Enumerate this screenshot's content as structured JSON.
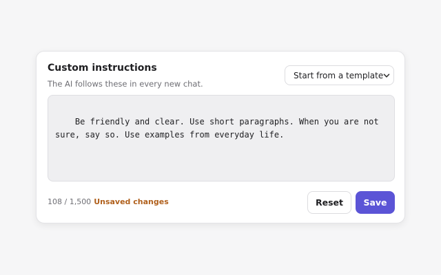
{
  "panel": {
    "title": "Custom instructions",
    "subtitle": "The AI follows these in every new chat.",
    "template_select": {
      "selected": "Start from a template",
      "icon": "chevron-down-icon"
    },
    "instructions_text": "Be friendly and clear. Use short paragraphs. When you are not sure, say so. Use examples from everyday life.",
    "character_count": "108 / 1,500",
    "status": "Unsaved changes",
    "buttons": {
      "reset": "Reset",
      "save": "Save"
    }
  },
  "colors": {
    "accent": "#5b54d6",
    "status_warning": "#b0601c",
    "page_background": "#f6f6f7",
    "textarea_background": "#efeff1"
  }
}
